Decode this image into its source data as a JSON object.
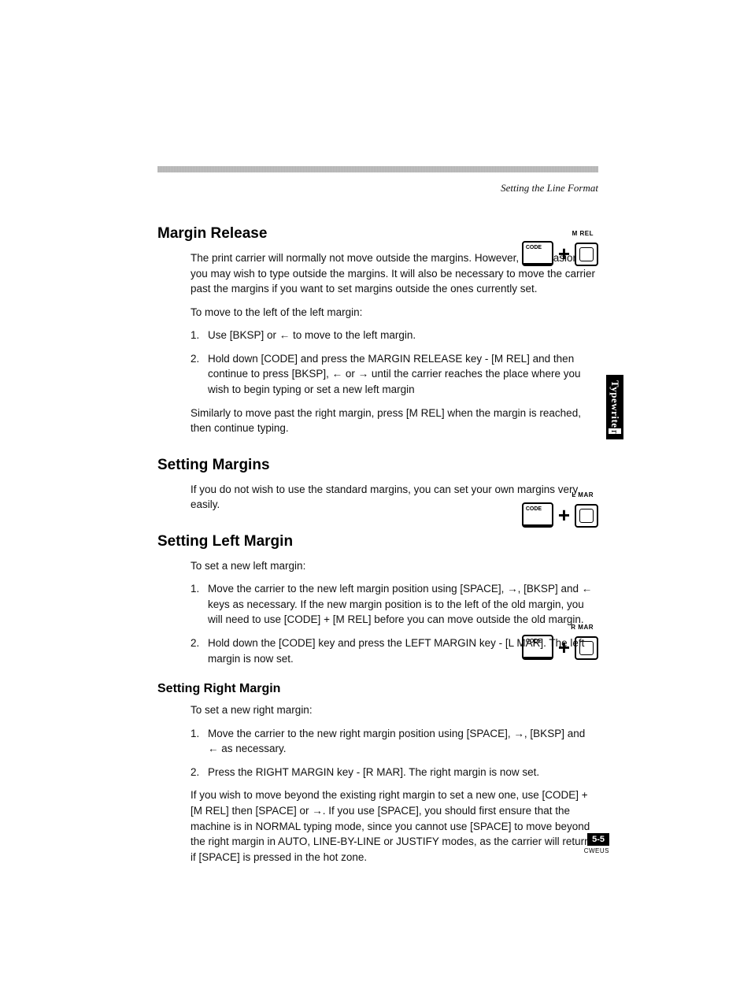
{
  "running_head": "Setting the Line Format",
  "side_tab": {
    "main": "Typewrite",
    "extra": "r"
  },
  "page_number": "5-5",
  "page_code": "CWEUS",
  "keycombo_labels": {
    "mrel": "M REL",
    "lmar": "L MAR",
    "rmar": "R MAR"
  },
  "sections": {
    "margin_release": {
      "title": "Margin Release",
      "p1": "The print carrier will normally not move outside the margins. However, on occasion, you may wish to type outside the margins. It will also be necessary to move the carrier past the margins if you want to set margins outside the ones currently set.",
      "p2": "To move to the left of the left margin:",
      "li1": "Use [BKSP] or ← to move to the left margin.",
      "li2": "Hold down [CODE] and press the MARGIN RELEASE key - [M REL] and then continue to press [BKSP], ← or → until the carrier reaches the place where you wish to begin typing or set a new left margin",
      "p3": "Similarly to move past the right margin, press [M REL] when the margin is reached, then continue typing."
    },
    "setting_margins": {
      "title": "Setting Margins",
      "p1": "If you do not wish to use the standard margins, you can set your own margins very easily."
    },
    "setting_left": {
      "title": "Setting Left Margin",
      "p1": "To set a new left margin:",
      "li1": "Move the carrier to the new left margin position using [SPACE], →, [BKSP] and ← keys as necessary. If the new margin position is to the left of the old margin, you will need to use [CODE] + [M REL]  before you can move outside the old margin.",
      "li2": "Hold down the [CODE] key and press the LEFT MARGIN key - [L MAR]. The left margin is now set."
    },
    "setting_right": {
      "title": "Setting Right Margin",
      "p1": "To set a new right margin:",
      "li1": "Move the carrier to the new right margin position using [SPACE], →, [BKSP] and ← as necessary.",
      "li2": "Press the RIGHT MARGIN key - [R MAR]. The right margin is now set.",
      "p2": "If you wish to move beyond the existing right margin to set a new one, use [CODE] + [M REL] then [SPACE] or →. If you use [SPACE], you should first ensure that the machine is in NORMAL typing mode, since you cannot use [SPACE] to move beyond the right margin in AUTO, LINE-BY-LINE or JUSTIFY modes, as the carrier will return if [SPACE] is pressed in the hot zone."
    }
  }
}
